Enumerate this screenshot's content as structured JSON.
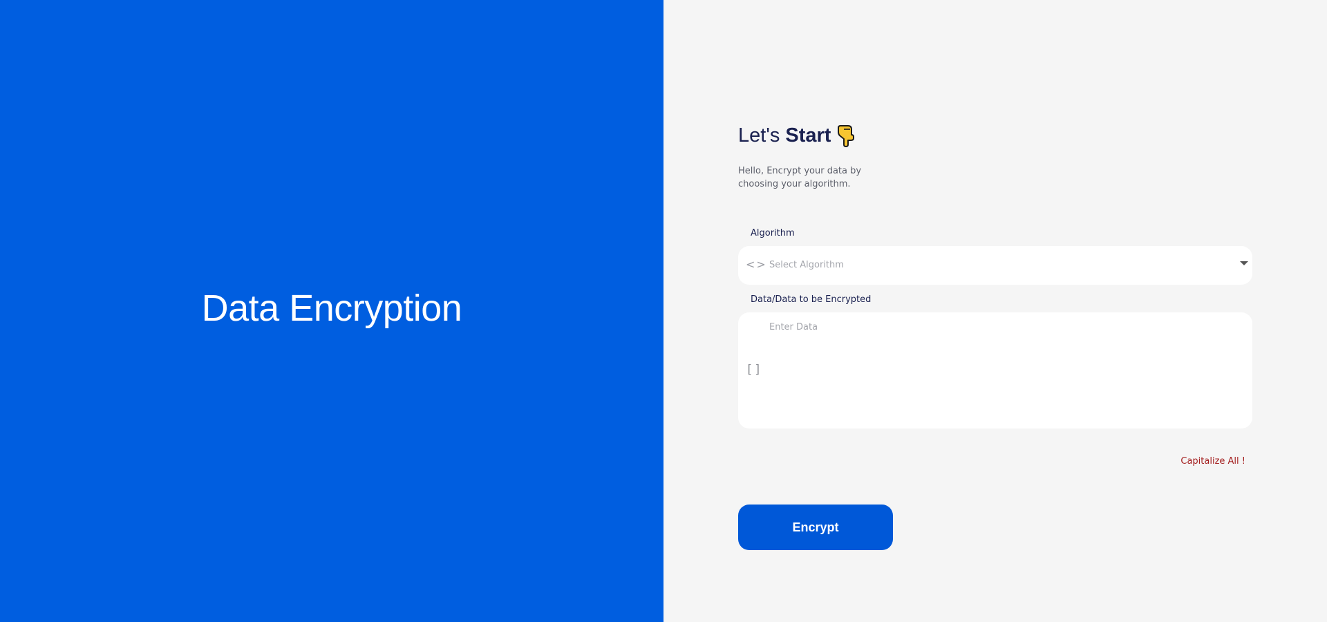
{
  "left": {
    "title": "Data Encryption",
    "background": "#005ee0"
  },
  "header": {
    "title_light": "Let's",
    "title_bold": "Start",
    "icon": "pointing-down-hand-icon",
    "subtitle": "Hello, Encrypt your data by choosing your algorithm."
  },
  "form": {
    "algorithm": {
      "label": "Algorithm",
      "placeholder": "Select Algorithm",
      "icon": "code-icon"
    },
    "data": {
      "label": "Data/Data to be Encrypted",
      "placeholder": "Enter Data",
      "icon": "brackets-icon"
    },
    "capitalize_link": "Capitalize All !",
    "submit_label": "Encrypt"
  },
  "colors": {
    "accent": "#005ee0",
    "button": "#0058d8",
    "panel_background": "#f5f5f5",
    "warning_link": "#a31d1d"
  }
}
